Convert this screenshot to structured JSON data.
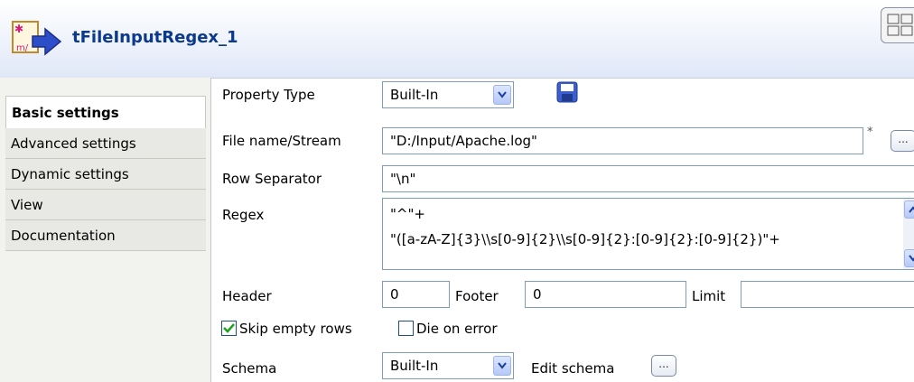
{
  "header": {
    "title": "tFileInputRegex_1",
    "icon": "component-icon",
    "layout_icon": "layout-grid-icon"
  },
  "sidebar": {
    "tabs": [
      {
        "label": "Basic settings",
        "active": true
      },
      {
        "label": "Advanced settings",
        "active": false
      },
      {
        "label": "Dynamic settings",
        "active": false
      },
      {
        "label": "View",
        "active": false
      },
      {
        "label": "Documentation",
        "active": false
      }
    ]
  },
  "form": {
    "property_type": {
      "label": "Property Type",
      "value": "Built-In"
    },
    "file_name": {
      "label": "File name/Stream",
      "value": "\"D:/Input/Apache.log\"",
      "required_mark": "*",
      "browse": "..."
    },
    "row_separator": {
      "label": "Row Separator",
      "value": "\"\\n\""
    },
    "regex": {
      "label": "Regex",
      "lines": [
        "\"^\"+",
        "\"([a-zA-Z]{3}\\\\s[0-9]{2}\\\\s[0-9]{2}:[0-9]{2}:[0-9]{2})\"+"
      ]
    },
    "header": {
      "label": "Header",
      "value": "0"
    },
    "footer": {
      "label": "Footer",
      "value": "0"
    },
    "limit": {
      "label": "Limit",
      "value": ""
    },
    "skip_empty_rows": {
      "label": "Skip empty rows",
      "checked": true
    },
    "die_on_error": {
      "label": "Die on error",
      "checked": false
    },
    "schema": {
      "label": "Schema",
      "value": "Built-In",
      "edit_label": "Edit schema",
      "edit_btn": "..."
    }
  },
  "colors": {
    "title": "#0b3a8c",
    "check": "#1aa31a",
    "field_border": "#7f9db9"
  }
}
